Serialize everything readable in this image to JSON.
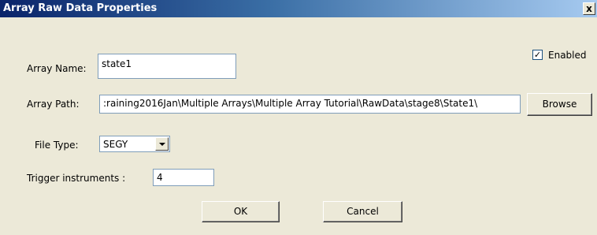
{
  "window": {
    "title": "Array Raw Data Properties",
    "close_glyph": "x"
  },
  "form": {
    "array_name_label": "Array Name:",
    "array_name_value": "state1",
    "enabled_label": "Enabled",
    "enabled_checked": true,
    "array_path_label": "Array Path:",
    "array_path_value": ":raining2016Jan\\Multiple Arrays\\Multiple Array Tutorial\\RawData\\stage8\\State1\\",
    "browse_label": "Browse",
    "file_type_label": "File Type:",
    "file_type_value": "SEGY",
    "trigger_label": "Trigger instruments :",
    "trigger_value": "4"
  },
  "buttons": {
    "ok_label": "OK",
    "cancel_label": "Cancel"
  },
  "icons": {
    "close": "close-icon",
    "check": "checkmark-icon",
    "dropdown": "chevron-down-icon"
  }
}
